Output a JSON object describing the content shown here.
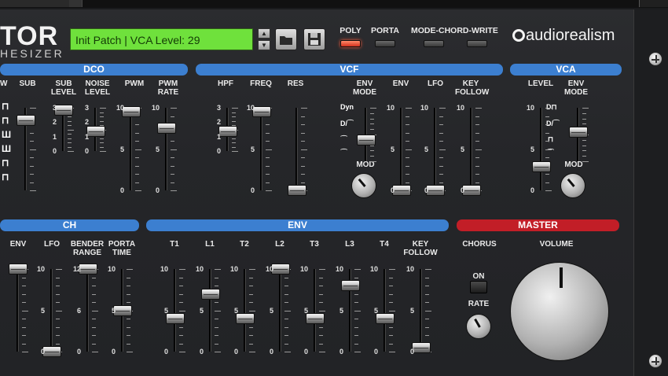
{
  "header": {
    "logo_text": "TOR",
    "logo_sub": "HESIZER",
    "lcd_text": "Init Patch | VCA Level: 29",
    "up_arrow_icon": "triangle-up",
    "down_arrow_icon": "triangle-down",
    "folder_icon": "folder-icon",
    "save_icon": "floppy-icon",
    "buttons": [
      {
        "label": "POLY",
        "state": "on"
      },
      {
        "label": "PORTA",
        "state": "off"
      },
      {
        "label": "MODE-CHORD-WRITE",
        "state": "off"
      }
    ],
    "brand": "audiorealism"
  },
  "sections_top": {
    "dco": {
      "title": "DCO",
      "columns": [
        "SUB",
        "SUB\nLEVEL",
        "NOISE\nLEVEL",
        "PWM",
        "PWM\nRATE"
      ],
      "sub_level_scale": [
        "3",
        "2",
        "1",
        "0"
      ],
      "noise_scale": [
        "3",
        "2",
        "1",
        "0"
      ],
      "pwm_scale": [
        "10",
        "5",
        "0"
      ],
      "pwm_rate_scale": [
        "10",
        "5",
        "0"
      ]
    },
    "vcf": {
      "title": "VCF",
      "columns": [
        "HPF",
        "FREQ",
        "RES",
        "ENV\nMODE",
        "ENV",
        "LFO",
        "KEY\nFOLLOW"
      ],
      "hpf_scale": [
        "3",
        "2",
        "1",
        "0"
      ],
      "freq_scale": [
        "10",
        "5",
        "0"
      ],
      "env_mode_labels": [
        "Dyn",
        "D/⁀",
        "⁀",
        "⁀"
      ],
      "mod_label": "MOD",
      "env_scale": [
        "10",
        "5",
        "0"
      ],
      "lfo_scale": [
        "10",
        "5",
        "0"
      ],
      "key_scale": [
        "10",
        "5",
        "0"
      ]
    },
    "vca": {
      "title": "VCA",
      "columns": [
        "LEVEL",
        "ENV\nMODE"
      ],
      "level_scale": [
        "10",
        "5",
        "0"
      ],
      "mod_label": "MOD"
    }
  },
  "sections_bottom": {
    "ch": {
      "title": "CH",
      "columns": [
        "ENV",
        "LFO",
        "BENDER\nRANGE",
        "PORTA\nTIME"
      ],
      "lfo_scale": [
        "10",
        "5",
        "0"
      ],
      "bender_scale": [
        "12",
        "6",
        "0"
      ],
      "porta_scale": [
        "10",
        "5",
        "0"
      ]
    },
    "env": {
      "title": "ENV",
      "columns": [
        "T1",
        "L1",
        "T2",
        "L2",
        "T3",
        "L3",
        "T4",
        "KEY\nFOLLOW"
      ],
      "scale": [
        "10",
        "5",
        "0"
      ]
    },
    "master": {
      "title": "MASTER",
      "chorus_label": "CHORUS",
      "volume_label": "VOLUME",
      "on_label": "ON",
      "rate_label": "RATE"
    }
  },
  "slider_levels": {
    "sub": 0.85,
    "sub_level": 0.95,
    "noise_level": 0.45,
    "pwm": 0.95,
    "pwm_rate": 0.75,
    "hpf": 0.45,
    "freq": 0.95,
    "res": 0.0,
    "env_mode": 0.4,
    "vcf_env": 0.0,
    "vcf_lfo": 0.0,
    "vcf_key": 0.0,
    "vca_level": 0.29,
    "vca_env_mode": 0.55,
    "ch_env": 1.0,
    "ch_lfo": 0.0,
    "bender": 1.0,
    "porta": 0.5,
    "t1": 0.4,
    "l1": 0.7,
    "t2": 0.4,
    "l2": 1.0,
    "t3": 0.4,
    "l3": 0.8,
    "t4": 0.4,
    "key_follow": 0.05
  },
  "colors": {
    "section_blue": "#3c7fd0",
    "section_red": "#c21e27",
    "lcd_green": "#6fe13c",
    "led_on": "#e03a22"
  }
}
